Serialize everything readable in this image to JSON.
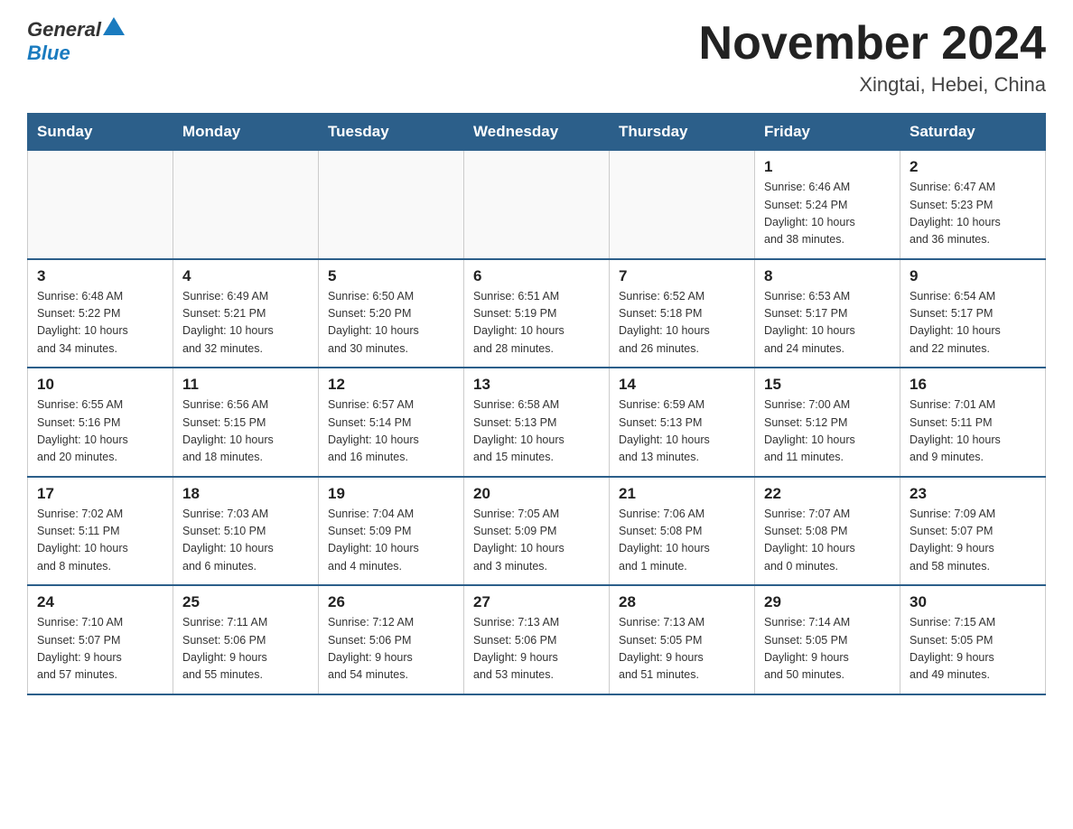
{
  "header": {
    "logo": {
      "general": "General",
      "blue": "Blue"
    },
    "title": "November 2024",
    "location": "Xingtai, Hebei, China"
  },
  "days_of_week": [
    "Sunday",
    "Monday",
    "Tuesday",
    "Wednesday",
    "Thursday",
    "Friday",
    "Saturday"
  ],
  "weeks": [
    [
      {
        "day": "",
        "info": ""
      },
      {
        "day": "",
        "info": ""
      },
      {
        "day": "",
        "info": ""
      },
      {
        "day": "",
        "info": ""
      },
      {
        "day": "",
        "info": ""
      },
      {
        "day": "1",
        "info": "Sunrise: 6:46 AM\nSunset: 5:24 PM\nDaylight: 10 hours\nand 38 minutes."
      },
      {
        "day": "2",
        "info": "Sunrise: 6:47 AM\nSunset: 5:23 PM\nDaylight: 10 hours\nand 36 minutes."
      }
    ],
    [
      {
        "day": "3",
        "info": "Sunrise: 6:48 AM\nSunset: 5:22 PM\nDaylight: 10 hours\nand 34 minutes."
      },
      {
        "day": "4",
        "info": "Sunrise: 6:49 AM\nSunset: 5:21 PM\nDaylight: 10 hours\nand 32 minutes."
      },
      {
        "day": "5",
        "info": "Sunrise: 6:50 AM\nSunset: 5:20 PM\nDaylight: 10 hours\nand 30 minutes."
      },
      {
        "day": "6",
        "info": "Sunrise: 6:51 AM\nSunset: 5:19 PM\nDaylight: 10 hours\nand 28 minutes."
      },
      {
        "day": "7",
        "info": "Sunrise: 6:52 AM\nSunset: 5:18 PM\nDaylight: 10 hours\nand 26 minutes."
      },
      {
        "day": "8",
        "info": "Sunrise: 6:53 AM\nSunset: 5:17 PM\nDaylight: 10 hours\nand 24 minutes."
      },
      {
        "day": "9",
        "info": "Sunrise: 6:54 AM\nSunset: 5:17 PM\nDaylight: 10 hours\nand 22 minutes."
      }
    ],
    [
      {
        "day": "10",
        "info": "Sunrise: 6:55 AM\nSunset: 5:16 PM\nDaylight: 10 hours\nand 20 minutes."
      },
      {
        "day": "11",
        "info": "Sunrise: 6:56 AM\nSunset: 5:15 PM\nDaylight: 10 hours\nand 18 minutes."
      },
      {
        "day": "12",
        "info": "Sunrise: 6:57 AM\nSunset: 5:14 PM\nDaylight: 10 hours\nand 16 minutes."
      },
      {
        "day": "13",
        "info": "Sunrise: 6:58 AM\nSunset: 5:13 PM\nDaylight: 10 hours\nand 15 minutes."
      },
      {
        "day": "14",
        "info": "Sunrise: 6:59 AM\nSunset: 5:13 PM\nDaylight: 10 hours\nand 13 minutes."
      },
      {
        "day": "15",
        "info": "Sunrise: 7:00 AM\nSunset: 5:12 PM\nDaylight: 10 hours\nand 11 minutes."
      },
      {
        "day": "16",
        "info": "Sunrise: 7:01 AM\nSunset: 5:11 PM\nDaylight: 10 hours\nand 9 minutes."
      }
    ],
    [
      {
        "day": "17",
        "info": "Sunrise: 7:02 AM\nSunset: 5:11 PM\nDaylight: 10 hours\nand 8 minutes."
      },
      {
        "day": "18",
        "info": "Sunrise: 7:03 AM\nSunset: 5:10 PM\nDaylight: 10 hours\nand 6 minutes."
      },
      {
        "day": "19",
        "info": "Sunrise: 7:04 AM\nSunset: 5:09 PM\nDaylight: 10 hours\nand 4 minutes."
      },
      {
        "day": "20",
        "info": "Sunrise: 7:05 AM\nSunset: 5:09 PM\nDaylight: 10 hours\nand 3 minutes."
      },
      {
        "day": "21",
        "info": "Sunrise: 7:06 AM\nSunset: 5:08 PM\nDaylight: 10 hours\nand 1 minute."
      },
      {
        "day": "22",
        "info": "Sunrise: 7:07 AM\nSunset: 5:08 PM\nDaylight: 10 hours\nand 0 minutes."
      },
      {
        "day": "23",
        "info": "Sunrise: 7:09 AM\nSunset: 5:07 PM\nDaylight: 9 hours\nand 58 minutes."
      }
    ],
    [
      {
        "day": "24",
        "info": "Sunrise: 7:10 AM\nSunset: 5:07 PM\nDaylight: 9 hours\nand 57 minutes."
      },
      {
        "day": "25",
        "info": "Sunrise: 7:11 AM\nSunset: 5:06 PM\nDaylight: 9 hours\nand 55 minutes."
      },
      {
        "day": "26",
        "info": "Sunrise: 7:12 AM\nSunset: 5:06 PM\nDaylight: 9 hours\nand 54 minutes."
      },
      {
        "day": "27",
        "info": "Sunrise: 7:13 AM\nSunset: 5:06 PM\nDaylight: 9 hours\nand 53 minutes."
      },
      {
        "day": "28",
        "info": "Sunrise: 7:13 AM\nSunset: 5:05 PM\nDaylight: 9 hours\nand 51 minutes."
      },
      {
        "day": "29",
        "info": "Sunrise: 7:14 AM\nSunset: 5:05 PM\nDaylight: 9 hours\nand 50 minutes."
      },
      {
        "day": "30",
        "info": "Sunrise: 7:15 AM\nSunset: 5:05 PM\nDaylight: 9 hours\nand 49 minutes."
      }
    ]
  ]
}
